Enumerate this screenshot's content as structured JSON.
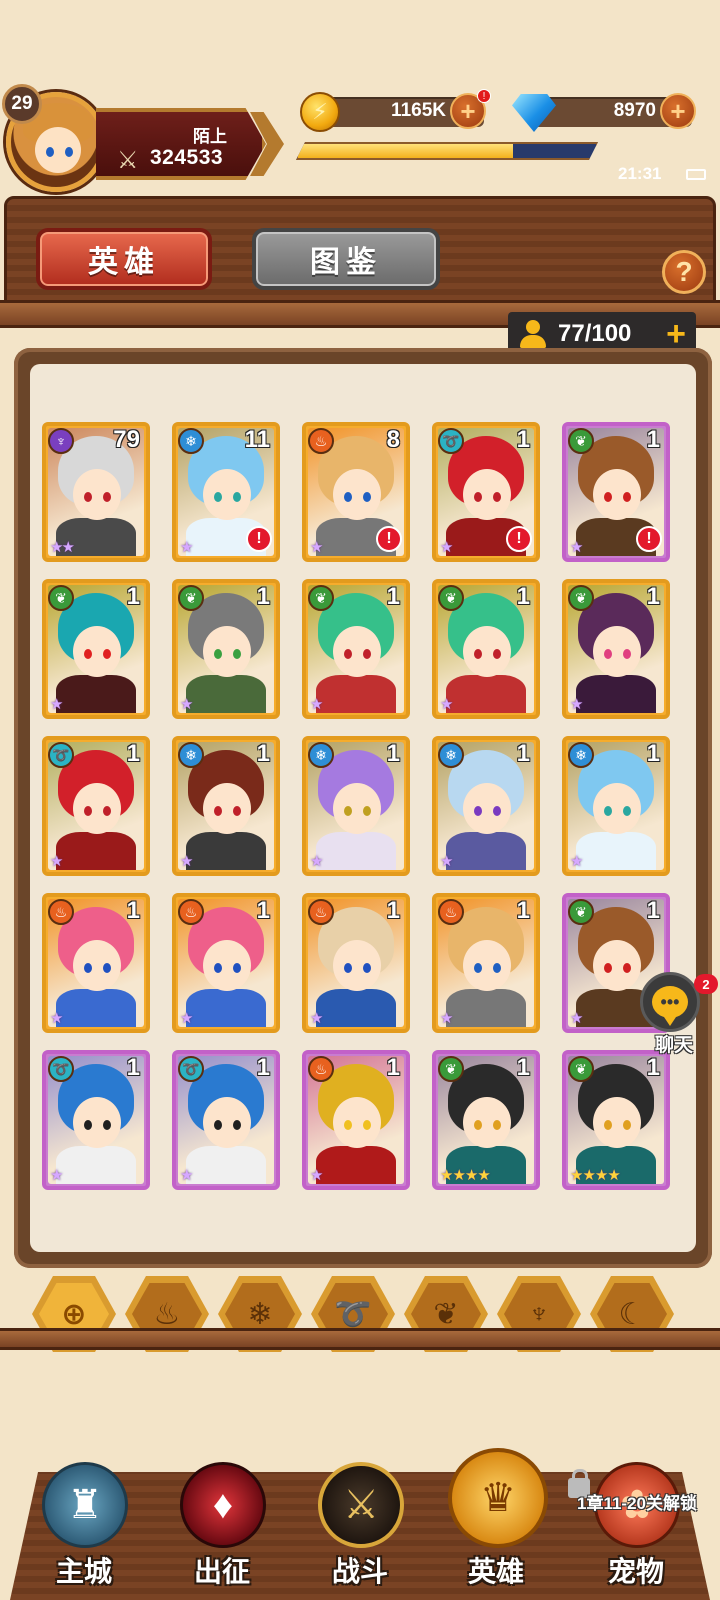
{
  "player": {
    "level": "29",
    "name": "陌上",
    "power": "324533",
    "power_icon": "crossed-swords-icon"
  },
  "currency": {
    "gold": "1165K",
    "gold_alert": "!",
    "gems": "8970",
    "plus": "+"
  },
  "exp_progress": 0.72,
  "status": {
    "time": "21:31"
  },
  "tabs": {
    "heroes": "英雄",
    "codex": "图鉴"
  },
  "help_label": "?",
  "capacity": {
    "value": "77/100",
    "plus": "+"
  },
  "element_colors": {
    "dark": "#7a3fbf",
    "water": "#2e8ed6",
    "fire": "#e8611f",
    "wind": "#2bb3c4",
    "nature": "#3a9a3a"
  },
  "heroes": [
    {
      "element": "dark",
      "level": "79",
      "rarity": "gold",
      "stars": "★★",
      "star_color": "purple",
      "alert": false,
      "hair": "#d8d8d8",
      "body": "#4a4a4a",
      "eye": "#c0202a"
    },
    {
      "element": "water",
      "level": "11",
      "rarity": "gold",
      "stars": "★",
      "star_color": "purple",
      "alert": true,
      "hair": "#7fc8f0",
      "body": "#e8f4fb",
      "eye": "#2aa7a0"
    },
    {
      "element": "fire",
      "level": "8",
      "rarity": "gold",
      "stars": "★",
      "star_color": "purple",
      "alert": true,
      "hair": "#e8b56a",
      "body": "#777777",
      "eye": "#1f5fc2"
    },
    {
      "element": "wind",
      "level": "1",
      "rarity": "gold",
      "stars": "★",
      "star_color": "purple",
      "alert": true,
      "hair": "#d2202a",
      "body": "#9a1a1a",
      "eye": "#c0202a"
    },
    {
      "element": "nature",
      "level": "1",
      "rarity": "purple",
      "stars": "★",
      "star_color": "purple",
      "alert": true,
      "hair": "#9a5a2a",
      "body": "#5a3a20",
      "eye": "#d02020"
    },
    {
      "element": "nature",
      "level": "1",
      "rarity": "gold",
      "stars": "★",
      "star_color": "purple",
      "alert": false,
      "hair": "#1aa7b0",
      "body": "#4a1a1a",
      "eye": "#e02020"
    },
    {
      "element": "nature",
      "level": "1",
      "rarity": "gold",
      "stars": "★",
      "star_color": "purple",
      "alert": false,
      "hair": "#7a7a7a",
      "body": "#4a6a3a",
      "eye": "#3aa040"
    },
    {
      "element": "nature",
      "level": "1",
      "rarity": "gold",
      "stars": "★",
      "star_color": "purple",
      "alert": false,
      "hair": "#36c08a",
      "body": "#c03030",
      "eye": "#c0202a"
    },
    {
      "element": "nature",
      "level": "1",
      "rarity": "gold",
      "stars": "★",
      "star_color": "purple",
      "alert": false,
      "hair": "#36c08a",
      "body": "#c03030",
      "eye": "#c0202a"
    },
    {
      "element": "nature",
      "level": "1",
      "rarity": "gold",
      "stars": "★",
      "star_color": "purple",
      "alert": false,
      "hair": "#5a2a5a",
      "body": "#3a1a3a",
      "eye": "#e04080"
    },
    {
      "element": "wind",
      "level": "1",
      "rarity": "gold",
      "stars": "★",
      "star_color": "purple",
      "alert": false,
      "hair": "#d2202a",
      "body": "#9a1a1a",
      "eye": "#c0202a"
    },
    {
      "element": "water",
      "level": "1",
      "rarity": "gold",
      "stars": "★",
      "star_color": "purple",
      "alert": false,
      "hair": "#7a2a1a",
      "body": "#3a3a3a",
      "eye": "#c0202a"
    },
    {
      "element": "water",
      "level": "1",
      "rarity": "gold",
      "stars": "★",
      "star_color": "purple",
      "alert": false,
      "hair": "#a57ae0",
      "body": "#e8e0f0",
      "eye": "#c0a020"
    },
    {
      "element": "water",
      "level": "1",
      "rarity": "gold",
      "stars": "★",
      "star_color": "purple",
      "alert": false,
      "hair": "#b8d8f0",
      "body": "#5a5aa0",
      "eye": "#7a3ac0"
    },
    {
      "element": "water",
      "level": "1",
      "rarity": "gold",
      "stars": "★",
      "star_color": "purple",
      "alert": false,
      "hair": "#7fc8f0",
      "body": "#e8f4fb",
      "eye": "#2aa7a0"
    },
    {
      "element": "fire",
      "level": "1",
      "rarity": "gold",
      "stars": "★",
      "star_color": "purple",
      "alert": false,
      "hair": "#ee5f8a",
      "body": "#3a6ad0",
      "eye": "#2050c0"
    },
    {
      "element": "fire",
      "level": "1",
      "rarity": "gold",
      "stars": "★",
      "star_color": "purple",
      "alert": false,
      "hair": "#ee5f8a",
      "body": "#3a6ad0",
      "eye": "#2050c0"
    },
    {
      "element": "fire",
      "level": "1",
      "rarity": "gold",
      "stars": "★",
      "star_color": "purple",
      "alert": false,
      "hair": "#e8d0a8",
      "body": "#2a5ab0",
      "eye": "#2050c0"
    },
    {
      "element": "fire",
      "level": "1",
      "rarity": "gold",
      "stars": "★",
      "star_color": "purple",
      "alert": false,
      "hair": "#e8b56a",
      "body": "#777777",
      "eye": "#1f5fc2"
    },
    {
      "element": "nature",
      "level": "1",
      "rarity": "purple",
      "stars": "★",
      "star_color": "purple",
      "alert": false,
      "hair": "#9a5a2a",
      "body": "#5a3a20",
      "eye": "#d02020"
    },
    {
      "element": "wind",
      "level": "1",
      "rarity": "purple",
      "stars": "★",
      "star_color": "purple",
      "alert": false,
      "hair": "#2a7ad0",
      "body": "#f0f0f0",
      "eye": "#202020"
    },
    {
      "element": "wind",
      "level": "1",
      "rarity": "purple",
      "stars": "★",
      "star_color": "purple",
      "alert": false,
      "hair": "#2a7ad0",
      "body": "#f0f0f0",
      "eye": "#202020"
    },
    {
      "element": "fire",
      "level": "1",
      "rarity": "purple",
      "stars": "★",
      "star_color": "purple",
      "alert": false,
      "hair": "#e0b020",
      "body": "#b01a1a",
      "eye": "#f0c020"
    },
    {
      "element": "nature",
      "level": "1",
      "rarity": "purple",
      "stars": "★★★★",
      "star_color": "gold",
      "alert": false,
      "hair": "#2a2a2a",
      "body": "#1a6a6a",
      "eye": "#e0a020"
    },
    {
      "element": "nature",
      "level": "1",
      "rarity": "purple",
      "stars": "★★★★",
      "star_color": "gold",
      "alert": false,
      "hair": "#2a2a2a",
      "body": "#1a6a6a",
      "eye": "#e0a020"
    }
  ],
  "chat": {
    "label": "聊天",
    "count": "2",
    "icon": "chat-bubble-icon"
  },
  "element_filters": [
    {
      "name": "all",
      "glyph": "⊕",
      "active": true
    },
    {
      "name": "fire",
      "glyph": "♨",
      "active": false
    },
    {
      "name": "water",
      "glyph": "❄",
      "active": false
    },
    {
      "name": "wind",
      "glyph": "➰",
      "active": false
    },
    {
      "name": "nature",
      "glyph": "❦",
      "active": false
    },
    {
      "name": "dark",
      "glyph": "♆",
      "active": false
    },
    {
      "name": "light",
      "glyph": "☾",
      "active": false
    }
  ],
  "bottom_nav": {
    "city": "主城",
    "expedition": "出征",
    "battle": "战斗",
    "heroes": "英雄",
    "pets": "宠物",
    "pets_unlock": "1章11-20关解锁"
  }
}
